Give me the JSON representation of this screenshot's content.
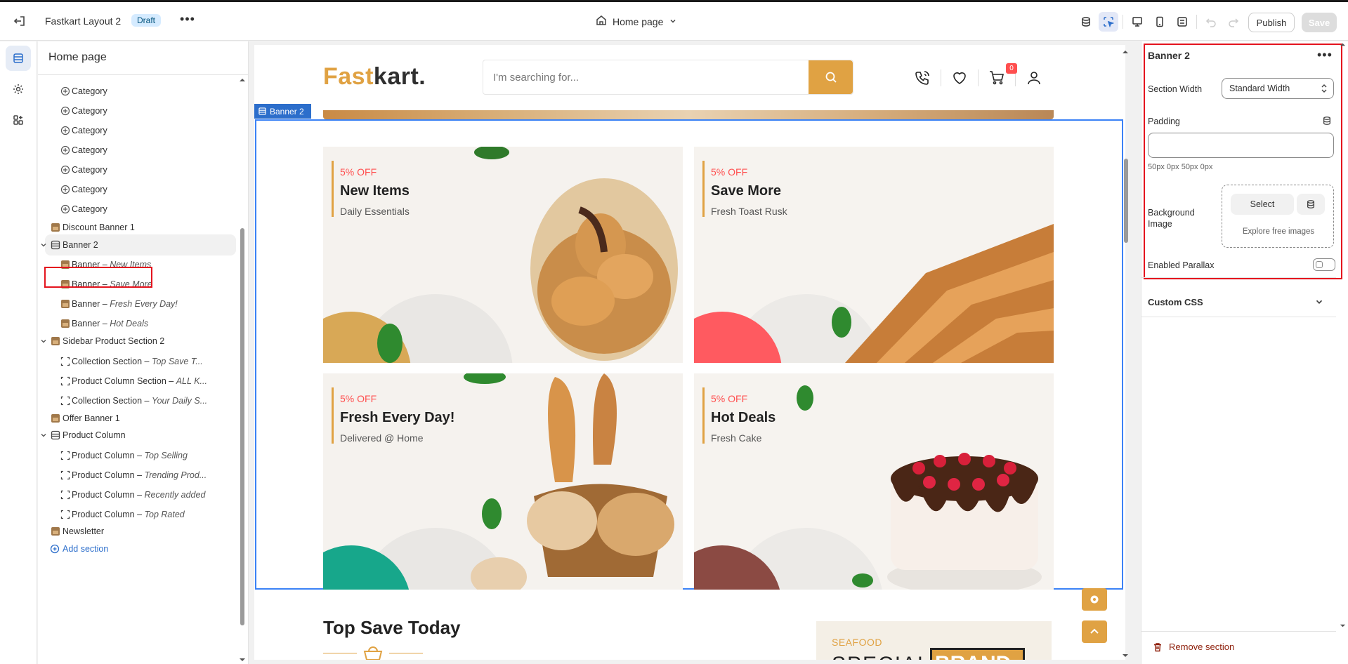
{
  "topbar": {
    "theme_name": "Fastkart Layout 2",
    "status_badge": "Draft",
    "page_selector": "Home page",
    "publish_label": "Publish",
    "save_label": "Save"
  },
  "left_panel": {
    "title": "Home page",
    "items": [
      {
        "label": "Category",
        "italic": "",
        "level": 2,
        "icon": "category-icon"
      },
      {
        "label": "Category",
        "italic": "",
        "level": 2,
        "icon": "category-icon"
      },
      {
        "label": "Category",
        "italic": "",
        "level": 2,
        "icon": "category-icon"
      },
      {
        "label": "Category",
        "italic": "",
        "level": 2,
        "icon": "category-icon"
      },
      {
        "label": "Category",
        "italic": "",
        "level": 2,
        "icon": "category-icon"
      },
      {
        "label": "Category",
        "italic": "",
        "level": 2,
        "icon": "category-icon"
      },
      {
        "label": "Category",
        "italic": "",
        "level": 2,
        "icon": "category-icon"
      },
      {
        "label": "Discount Banner 1",
        "italic": "",
        "level": 1,
        "icon": "image-thumb-icon"
      },
      {
        "label": "Banner 2",
        "italic": "",
        "level": 1,
        "icon": "section-icon",
        "expanded": true,
        "selected": true
      },
      {
        "label": "Banner – ",
        "italic": "New Items",
        "level": 2,
        "icon": "image-thumb-icon"
      },
      {
        "label": "Banner – ",
        "italic": "Save More",
        "level": 2,
        "icon": "image-thumb-icon"
      },
      {
        "label": "Banner – ",
        "italic": "Fresh Every Day!",
        "level": 2,
        "icon": "image-thumb-icon"
      },
      {
        "label": "Banner – ",
        "italic": "Hot Deals",
        "level": 2,
        "icon": "image-thumb-icon"
      },
      {
        "label": "Sidebar Product Section 2",
        "italic": "",
        "level": 1,
        "icon": "image-thumb-icon",
        "expanded": true
      },
      {
        "label": "Collection Section – ",
        "italic": "Top Save T...",
        "level": 2,
        "icon": "block-icon"
      },
      {
        "label": "Product Column Section – ",
        "italic": "ALL K...",
        "level": 2,
        "icon": "block-icon"
      },
      {
        "label": "Collection Section – ",
        "italic": "Your Daily S...",
        "level": 2,
        "icon": "block-icon"
      },
      {
        "label": "Offer Banner 1",
        "italic": "",
        "level": 1,
        "icon": "image-thumb-icon"
      },
      {
        "label": "Product Column",
        "italic": "",
        "level": 1,
        "icon": "section-icon",
        "expanded": true
      },
      {
        "label": "Product Column – ",
        "italic": "Top Selling",
        "level": 2,
        "icon": "block-icon"
      },
      {
        "label": "Product Column – ",
        "italic": "Trending Prod...",
        "level": 2,
        "icon": "block-icon"
      },
      {
        "label": "Product Column – ",
        "italic": "Recently added",
        "level": 2,
        "icon": "block-icon"
      },
      {
        "label": "Product Column – ",
        "italic": "Top Rated",
        "level": 2,
        "icon": "block-icon"
      },
      {
        "label": "Newsletter",
        "italic": "",
        "level": 1,
        "icon": "image-thumb-icon"
      }
    ],
    "add_section_label": "Add section"
  },
  "preview": {
    "logo_part1": "Fast",
    "logo_part2": "kart.",
    "search_placeholder": "I'm searching for...",
    "cart_count": "0",
    "selected_tag": "Banner 2",
    "banners": [
      {
        "offer": "5% OFF",
        "title": "New Items",
        "subtitle": "Daily Essentials",
        "circle_color": "#d8a856"
      },
      {
        "offer": "5% OFF",
        "title": "Save More",
        "subtitle": "Fresh Toast Rusk",
        "circle_color": "#ff5a60"
      },
      {
        "offer": "5% OFF",
        "title": "Fresh Every Day!",
        "subtitle": "Delivered @ Home",
        "circle_color": "#17a78b"
      },
      {
        "offer": "5% OFF",
        "title": "Hot Deals",
        "subtitle": "Fresh Cake",
        "circle_color": "#8b4a43"
      }
    ],
    "section_title": "Top Save Today",
    "promo_label": "SEAFOOD",
    "promo_big_text": "SPECIAL",
    "promo_brand": "BRAND"
  },
  "right_panel": {
    "title": "Banner 2",
    "section_width_label": "Section Width",
    "section_width_value": "Standard Width",
    "padding_label": "Padding",
    "padding_hint": "50px 0px 50px 0px",
    "background_image_label": "Background Image",
    "select_label": "Select",
    "explore_label": "Explore free images",
    "parallax_label": "Enabled Parallax",
    "parallax_on": false,
    "custom_css_label": "Custom CSS",
    "remove_label": "Remove section"
  },
  "colors": {
    "accent": "#e0a243",
    "offer_red": "#ff4f4f",
    "selection_blue": "#2c6ecb",
    "highlight_red": "#e4141e",
    "remove_red": "#8e1f0b"
  }
}
